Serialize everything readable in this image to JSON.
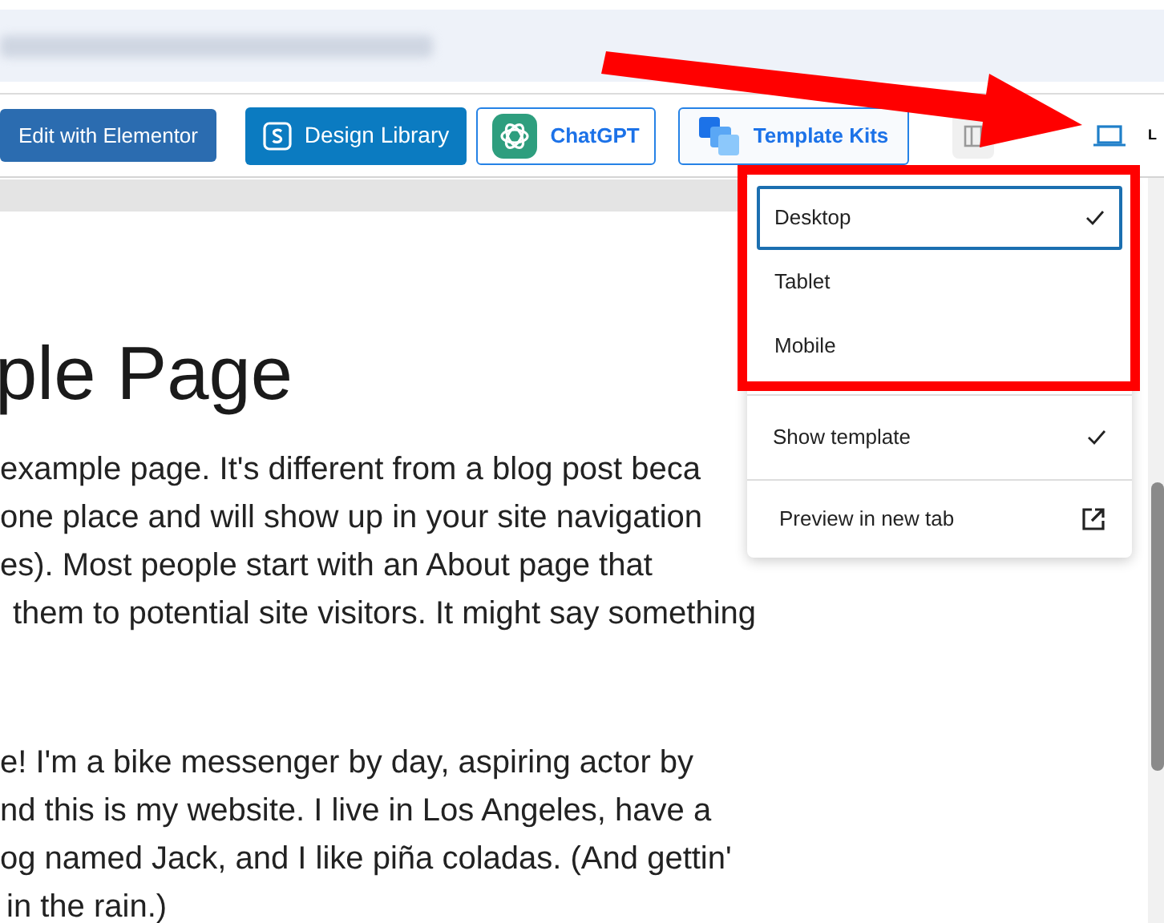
{
  "toolbar": {
    "buttons": [
      {
        "label": "Edit with Elementor",
        "kind": "solid-dark"
      },
      {
        "label": "Design Library",
        "kind": "solid"
      },
      {
        "label": "ChatGPT",
        "kind": "outline-gpt"
      },
      {
        "label": "Template Kits",
        "kind": "outline-kits"
      }
    ],
    "trailing_label": "L"
  },
  "page": {
    "title": "ple Page",
    "paragraph_1": [
      "example page. It's different from a blog post beca",
      "one place and will show up in your site navigation",
      "es). Most people start with an About page that",
      "them to potential site visitors. It might say something"
    ],
    "paragraph_2": [
      "e! I'm a bike messenger by day, aspiring actor by",
      "nd this is my website. I live in Los Angeles, have a",
      "og named Jack, and I like piña coladas. (And gettin'",
      "in the rain.)"
    ]
  },
  "view_menu": {
    "devices": [
      {
        "label": "Desktop",
        "selected": true
      },
      {
        "label": "Tablet",
        "selected": false
      },
      {
        "label": "Mobile",
        "selected": false
      }
    ],
    "show_template": {
      "label": "Show template",
      "checked": true
    },
    "preview": {
      "label": "Preview in new tab"
    }
  }
}
